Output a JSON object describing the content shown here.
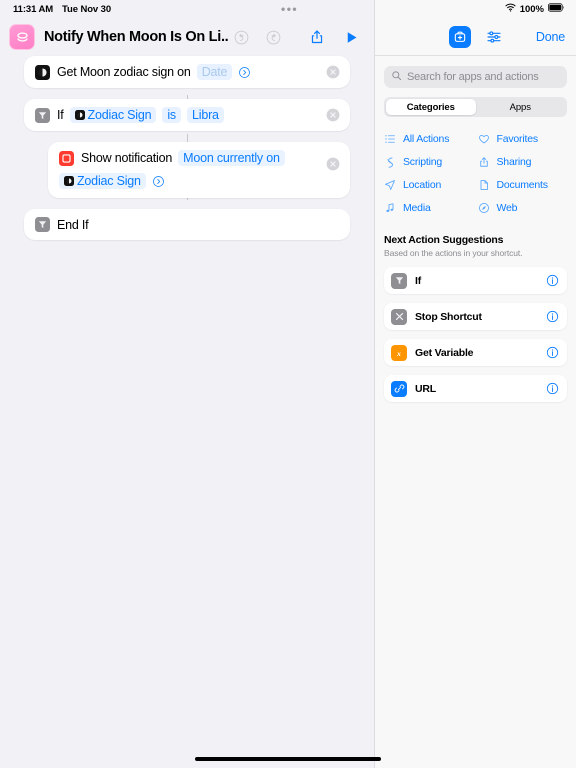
{
  "status_bar": {
    "time": "11:31 AM",
    "date": "Tue Nov 30",
    "menu_dots": "•••",
    "battery_percent": "100%",
    "wifi_icon": "wifi-icon",
    "battery_icon": "battery-icon"
  },
  "editor": {
    "app_icon": "shortcuts-icon",
    "title": "Notify When Moon Is On Li...",
    "undo_icon": "undo-icon",
    "redo_icon": "redo-icon",
    "share_icon": "share-icon",
    "play_icon": "play-icon",
    "actions": [
      {
        "icon": "moon-icon",
        "icon_style": "moon",
        "indent": false,
        "text": "Get Moon zodiac sign on",
        "token": "Date",
        "token_style": "muted",
        "has_disclosure": true,
        "has_remove": true
      },
      {
        "icon": "if-icon",
        "icon_style": "gray",
        "indent": false,
        "text": "If",
        "var_token": "Zodiac Sign",
        "operator": "is",
        "value": "Libra",
        "has_remove": true
      },
      {
        "icon": "notification-icon",
        "icon_style": "red",
        "indent": true,
        "text": "Show notification",
        "field_text": "Moon currently on",
        "field_token": "Zodiac Sign",
        "has_disclosure": true,
        "has_remove": true
      },
      {
        "icon": "if-icon",
        "icon_style": "gray",
        "indent": false,
        "text": "End If",
        "has_remove": false
      }
    ]
  },
  "panel": {
    "add_action_icon": "add-action-icon",
    "sliders_icon": "sliders-icon",
    "done_label": "Done",
    "search": {
      "icon": "search-icon",
      "placeholder": "Search for apps and actions",
      "value": ""
    },
    "segments": [
      {
        "label": "Categories",
        "active": true
      },
      {
        "label": "Apps",
        "active": false
      }
    ],
    "categories": [
      {
        "label": "All Actions",
        "icon": "list-icon"
      },
      {
        "label": "Favorites",
        "icon": "heart-icon"
      },
      {
        "label": "Scripting",
        "icon": "scripting-icon"
      },
      {
        "label": "Sharing",
        "icon": "share-icon"
      },
      {
        "label": "Location",
        "icon": "location-icon"
      },
      {
        "label": "Documents",
        "icon": "document-icon"
      },
      {
        "label": "Media",
        "icon": "music-note-icon"
      },
      {
        "label": "Web",
        "icon": "safari-icon"
      }
    ],
    "suggestions": {
      "title": "Next Action Suggestions",
      "subtitle": "Based on the actions in your shortcut.",
      "items": [
        {
          "label": "If",
          "icon": "if-icon",
          "icon_style": "gray",
          "info_icon": "info-icon"
        },
        {
          "label": "Stop Shortcut",
          "icon": "x-icon",
          "icon_style": "gray",
          "info_icon": "info-icon"
        },
        {
          "label": "Get Variable",
          "icon": "variable-icon",
          "icon_style": "orange",
          "info_icon": "info-icon"
        },
        {
          "label": "URL",
          "icon": "link-icon",
          "icon_style": "blue",
          "info_icon": "info-icon"
        }
      ]
    }
  },
  "colors": {
    "accent": "#0a7cff",
    "background": "#f2f1f6",
    "panel_background": "#f8f8f9",
    "token_background": "#e7f1ff",
    "red": "#ff3b30",
    "orange": "#ff9500",
    "gray": "#8e8e93"
  }
}
